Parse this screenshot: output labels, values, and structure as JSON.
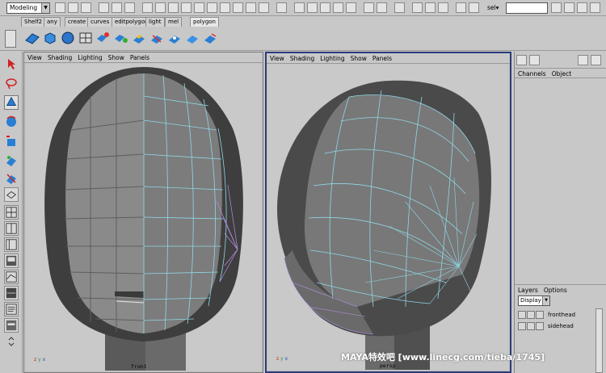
{
  "status_line": {
    "mode": "Modeling",
    "sel_label": "sel▾",
    "sel_value": ""
  },
  "shelf": {
    "tabs": [
      "Shelf2",
      "any",
      "create",
      "curves",
      "editpolygon",
      "light",
      "mel",
      "polygon"
    ]
  },
  "viewports": {
    "menu": [
      "View",
      "Shading",
      "Lighting",
      "Show",
      "Panels"
    ],
    "front_camera": "front",
    "persp_camera": "persp"
  },
  "channel_box": {
    "menu": [
      "Channels",
      "Object"
    ]
  },
  "layers": {
    "menu": [
      "Layers",
      "Options"
    ],
    "display_value": "Display",
    "items": [
      "fronthead",
      "sidehead"
    ]
  },
  "watermark": "MAYA特效吧 [www.linecg.com/tieba/1745]",
  "colors": {
    "ui_gray": "#c8c8c8",
    "viewport_bg": "#c9c9c9",
    "wireframe": "#8fd8e8",
    "mesh_dark": "#4a4a4a",
    "mesh_light": "#8a8a8a"
  }
}
